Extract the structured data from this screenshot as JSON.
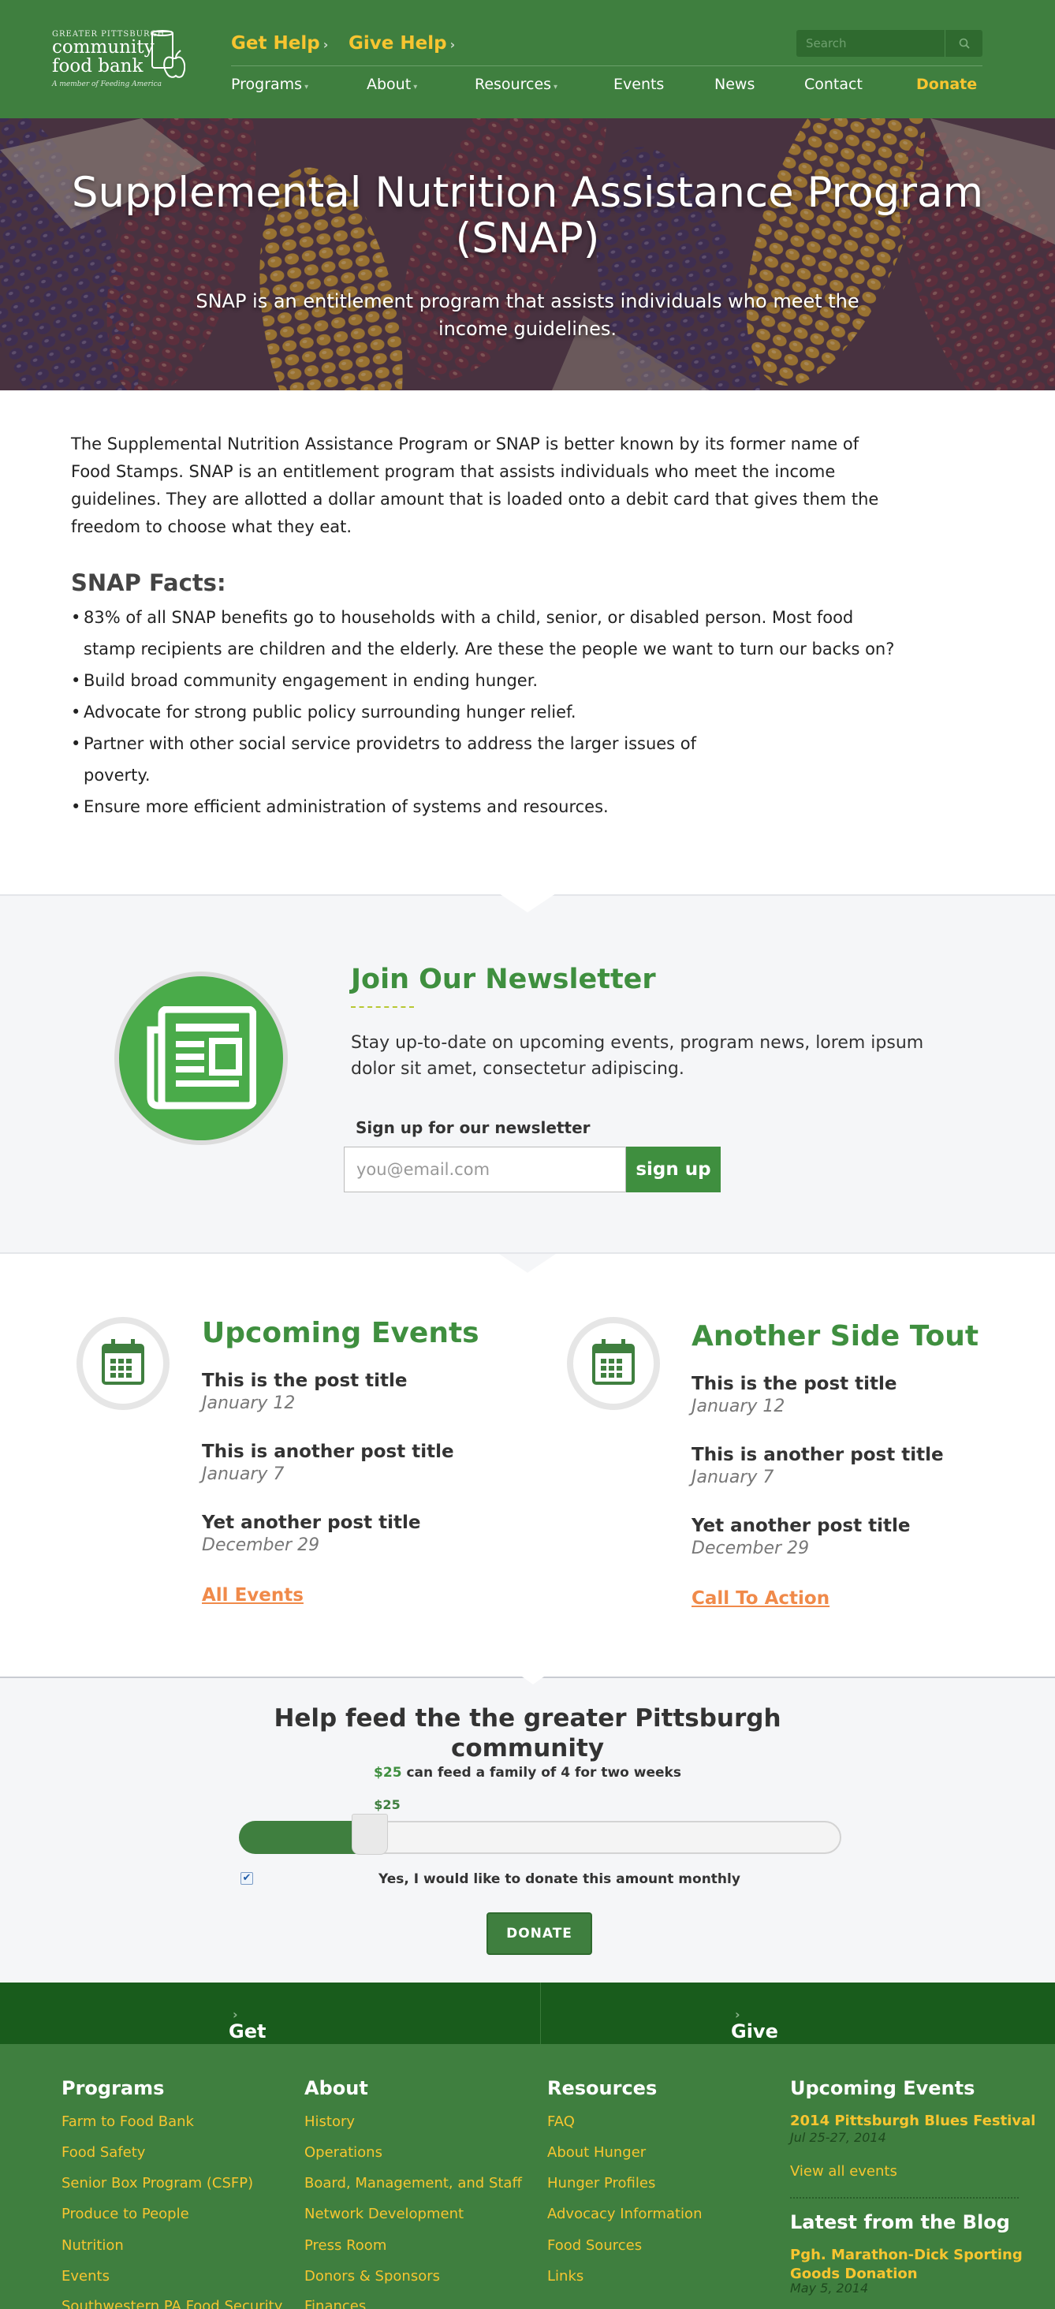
{
  "header": {
    "logo": {
      "line1": "GREATER PITTSBURGH",
      "line2": "community food bank",
      "tagline": "A member of Feeding America"
    },
    "cta_get_help": "Get Help",
    "cta_give_help": "Give Help",
    "search_placeholder": "Search",
    "nav": [
      "Programs",
      "About",
      "Resources",
      "Events",
      "News",
      "Contact",
      "Donate"
    ]
  },
  "hero": {
    "title": "Supplemental Nutrition Assistance Program (SNAP)",
    "subtitle": "SNAP is an entitlement program that assists individuals who meet the income guidelines."
  },
  "main": {
    "intro": "The Supplemental Nutrition Assistance Program or SNAP is better known by its former name of Food Stamps.  SNAP is an entitlement program that assists individuals who meet the income guidelines. They are allotted a dollar amount  that is loaded onto a debit card that gives them the freedom to choose what they eat.",
    "facts_title": "SNAP Facts:",
    "facts": [
      "83% of all SNAP benefits go to households with a child, senior, or disabled person. Most food stamp recipients are children and the elderly. Are these the people we want to turn our backs on?",
      "Build broad community engagement in ending hunger.",
      "Advocate for strong public policy surrounding hunger relief.",
      "Partner with other social service providetrs to address the larger issues of poverty.",
      "Ensure more efficient administration of systems and resources."
    ]
  },
  "newsletter": {
    "title": "Join Our Newsletter",
    "description": "Stay up-to-date on upcoming events, program news, lorem ipsum dolor sit amet, consectetur adipiscing.",
    "label": "Sign up for our newsletter",
    "placeholder": "you@email.com",
    "button": "sign up"
  },
  "events_left": {
    "title": "Upcoming Events",
    "posts": [
      {
        "title": "This is the post title",
        "date": "January 12"
      },
      {
        "title": "This is another post title",
        "date": "January 7"
      },
      {
        "title": "Yet another post title",
        "date": "December 29"
      }
    ],
    "link": "All Events"
  },
  "events_right": {
    "title": "Another Side Tout",
    "posts": [
      {
        "title": "This is the post title",
        "date": "January 12"
      },
      {
        "title": "This is another post title",
        "date": "January 7"
      },
      {
        "title": "Yet another post title",
        "date": "December 29"
      }
    ],
    "link": "Call To Action"
  },
  "donate": {
    "title": "Help feed the the greater Pittsburgh community",
    "amount": "$25",
    "sub": "can feed a family of 4 for two weeks",
    "slider_value": "$25",
    "slider_fraction": 0.25,
    "monthly_label": "Yes, I would like to donate this amount monthly",
    "button": "DONATE"
  },
  "footer_cta": {
    "get_help": "Get Help",
    "give_help": "Give Help"
  },
  "footer": {
    "programs": {
      "title": "Programs",
      "links": [
        "Farm to Food Bank",
        "Food Safety",
        "Senior Box Program (CSFP)",
        "Produce to People",
        "Nutrition",
        "Events",
        "Southwestern PA Food Security"
      ]
    },
    "about": {
      "title": "About",
      "links": [
        "History",
        "Operations",
        "Board, Management, and Staff",
        "Network Development",
        "Press Room",
        "Donors & Sponsors",
        "Finances"
      ]
    },
    "resources": {
      "title": "Resources",
      "links": [
        "FAQ",
        "About Hunger",
        "Hunger Profiles",
        "Advocacy Information",
        "Food Sources",
        "Links"
      ]
    },
    "upcoming": {
      "title": "Upcoming Events",
      "event_title": "2014 Pittsburgh Blues Festival",
      "event_date": "Jul 25-27, 2014",
      "view_all": "View all events"
    },
    "blog": {
      "title": "Latest from the Blog",
      "post_title": "Pgh. Marathon-Dick Sporting Goods Donation",
      "post_date": "May 5, 2014"
    }
  },
  "colors": {
    "brand_green": "#3f7f3f",
    "accent_yellow": "#f7c530",
    "link_orange": "#f08a4a",
    "dark_green": "#195c1c"
  }
}
